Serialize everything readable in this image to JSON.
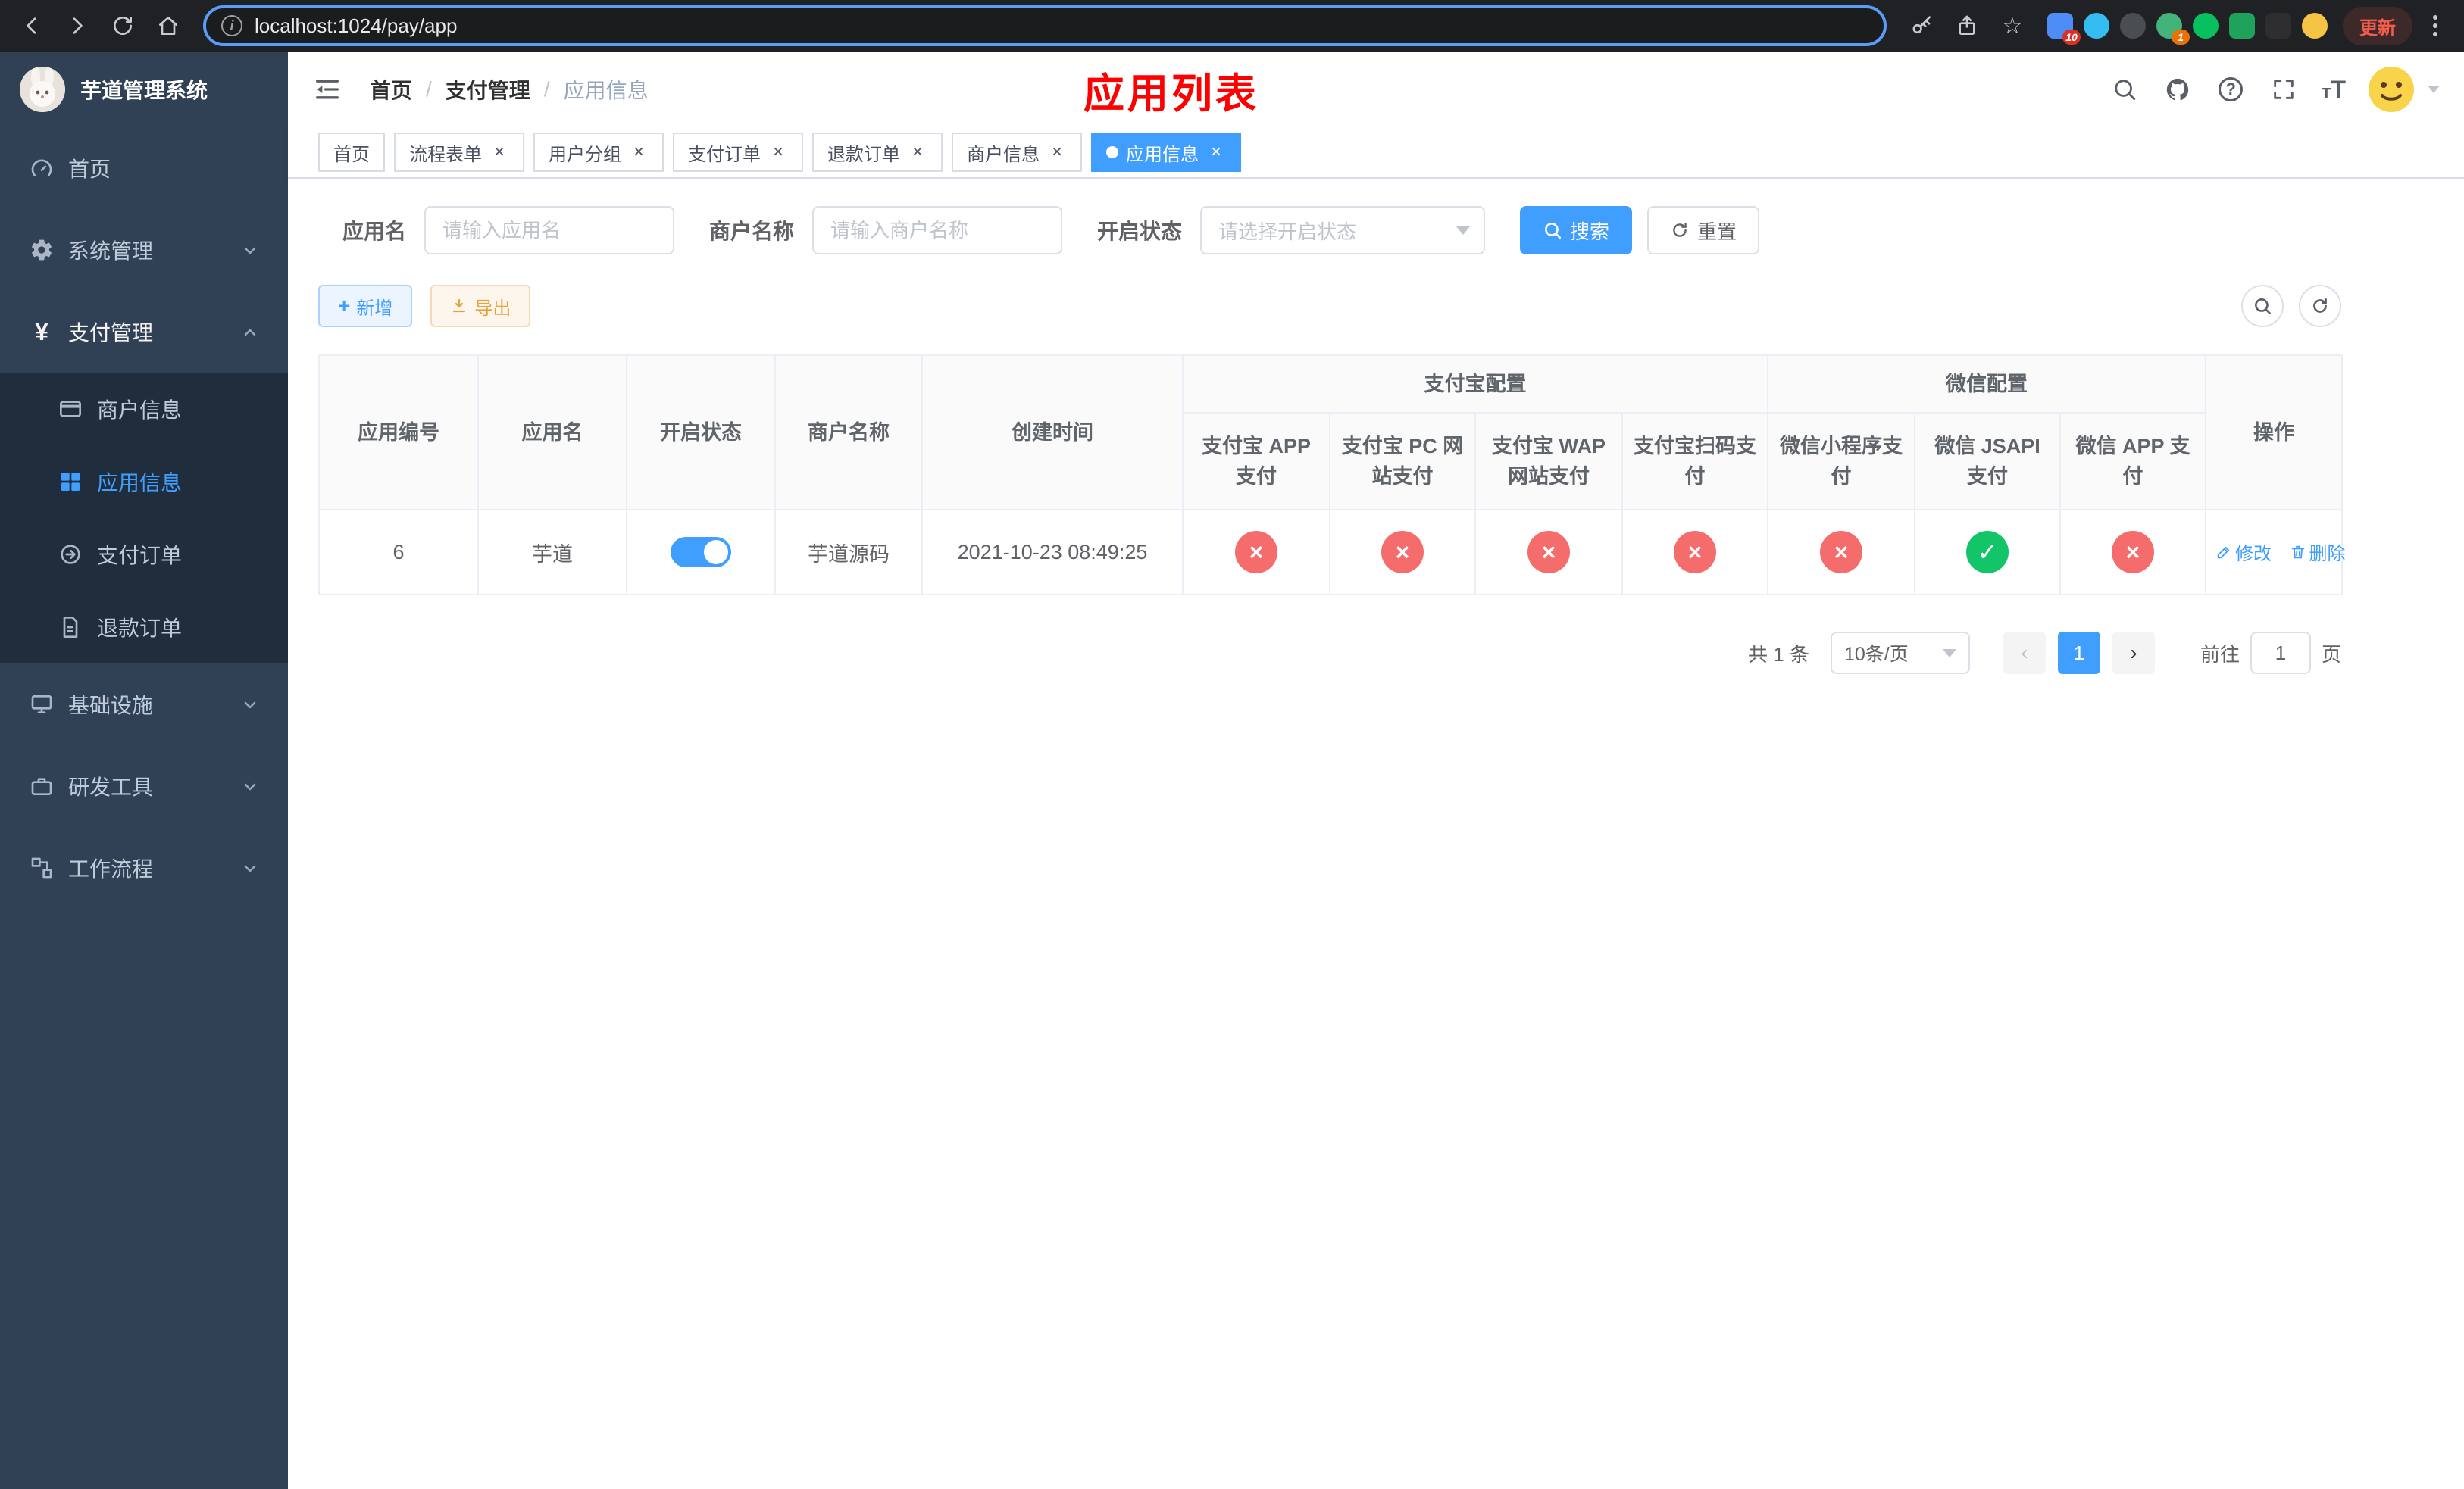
{
  "browser": {
    "url": "localhost:1024/pay/app",
    "update_label": "更新",
    "ext_badge_1": "10",
    "ext_badge_2": "1"
  },
  "icons": {
    "close": "×",
    "star": "☆",
    "info": "i",
    "help": "?",
    "yen": "¥",
    "plus": "+",
    "font_size": "T",
    "breadcrumb_sep": "/",
    "prev": "‹",
    "next": "›"
  },
  "sidebar": {
    "title": "芋道管理系统",
    "items": [
      {
        "label": "首页"
      },
      {
        "label": "系统管理"
      },
      {
        "label": "支付管理"
      },
      {
        "label": "商户信息"
      },
      {
        "label": "应用信息"
      },
      {
        "label": "支付订单"
      },
      {
        "label": "退款订单"
      },
      {
        "label": "基础设施"
      },
      {
        "label": "研发工具"
      },
      {
        "label": "工作流程"
      }
    ]
  },
  "header": {
    "breadcrumb": [
      {
        "label": "首页"
      },
      {
        "label": "支付管理"
      },
      {
        "label": "应用信息"
      }
    ],
    "title": "应用列表"
  },
  "tabs": [
    {
      "label": "首页"
    },
    {
      "label": "流程表单"
    },
    {
      "label": "用户分组"
    },
    {
      "label": "支付订单"
    },
    {
      "label": "退款订单"
    },
    {
      "label": "商户信息"
    },
    {
      "label": "应用信息"
    }
  ],
  "filters": {
    "app_name_label": "应用名",
    "app_name_placeholder": "请输入应用名",
    "merchant_label": "商户名称",
    "merchant_placeholder": "请输入商户名称",
    "status_label": "开启状态",
    "status_placeholder": "请选择开启状态",
    "search_label": "搜索",
    "reset_label": "重置"
  },
  "toolbar": {
    "add_label": "新增",
    "export_label": "导出"
  },
  "table": {
    "groups": {
      "alipay": "支付宝配置",
      "wechat": "微信配置"
    },
    "columns": [
      "应用编号",
      "应用名",
      "开启状态",
      "商户名称",
      "创建时间",
      "支付宝 APP 支付",
      "支付宝 PC 网站支付",
      "支付宝 WAP 网站支付",
      "支付宝扫码支付",
      "微信小程序支付",
      "微信 JSAPI 支付",
      "微信 APP 支付",
      "操作"
    ],
    "rows": [
      {
        "app_id": "6",
        "app_name": "芋道",
        "status_cls": "switch on",
        "merchant_name": "芋道源码",
        "create_time": "2021-10-23 08:49:25",
        "configs": [
          {
            "name": "alipay-app-pay",
            "glyph": "×",
            "cls": "cfg off"
          },
          {
            "name": "alipay-pc-pay",
            "glyph": "×",
            "cls": "cfg off"
          },
          {
            "name": "alipay-wap-pay",
            "glyph": "×",
            "cls": "cfg off"
          },
          {
            "name": "alipay-qr-pay",
            "glyph": "×",
            "cls": "cfg off"
          },
          {
            "name": "wechat-lite-pay",
            "glyph": "×",
            "cls": "cfg off"
          },
          {
            "name": "wechat-jsapi-pay",
            "glyph": "✓",
            "cls": "cfg on"
          },
          {
            "name": "wechat-app-pay",
            "glyph": "×",
            "cls": "cfg off"
          }
        ],
        "edit_label": "修改",
        "delete_label": "删除"
      }
    ]
  },
  "pagination": {
    "total": "共 1 条",
    "page_size": "10条/页",
    "page": "1",
    "goto_label": "前往",
    "goto_value": "1",
    "page_unit": "页"
  },
  "colors": {
    "accent": "#409eff",
    "title_red": "#ff0000",
    "enabled_green": "#12c569",
    "disabled_red": "#f56c6c",
    "warning_orange": "#e6a23c",
    "sidebar_bg": "#304156",
    "submenu_bg": "#1f2d3d"
  }
}
